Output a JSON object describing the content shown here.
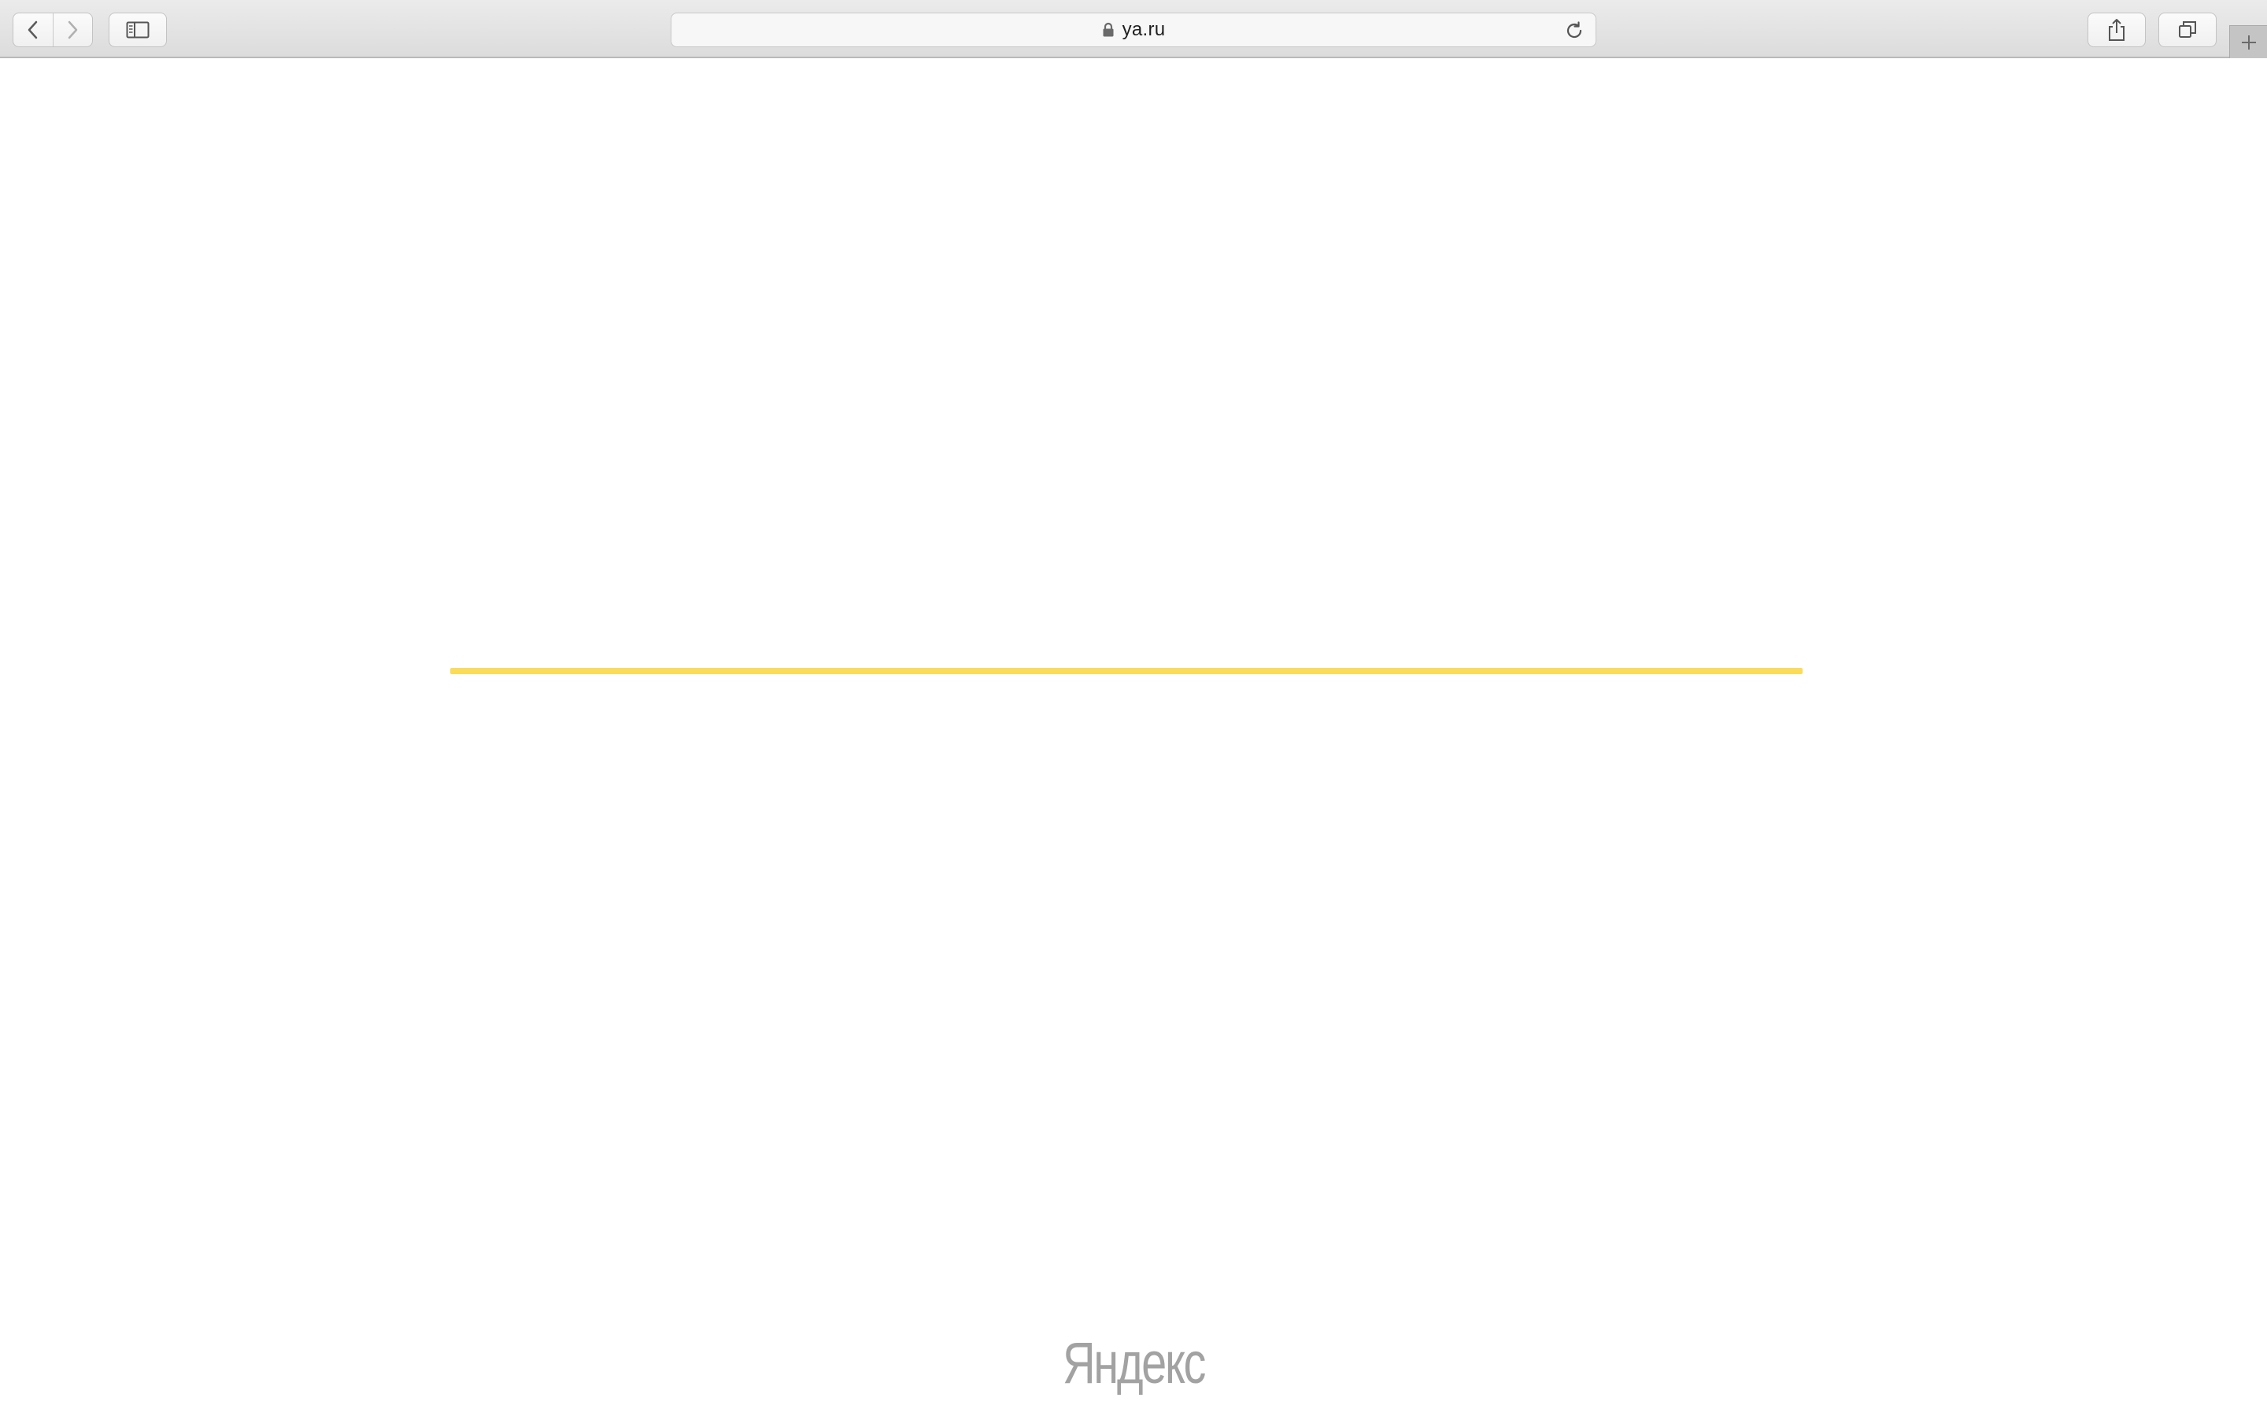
{
  "browser": {
    "address_bar": {
      "url": "ya.ru",
      "secure": true
    },
    "icons": {
      "back": "chevron-left-icon",
      "forward": "chevron-right-icon",
      "sidebar": "sidebar-icon",
      "lock": "lock-icon",
      "reload": "reload-icon",
      "share": "share-icon",
      "tabs": "tab-overview-icon",
      "new_tab": "plus-icon"
    }
  },
  "page": {
    "loading_bar_color": "#fadc5a",
    "footer_logo": "Яндекс"
  }
}
